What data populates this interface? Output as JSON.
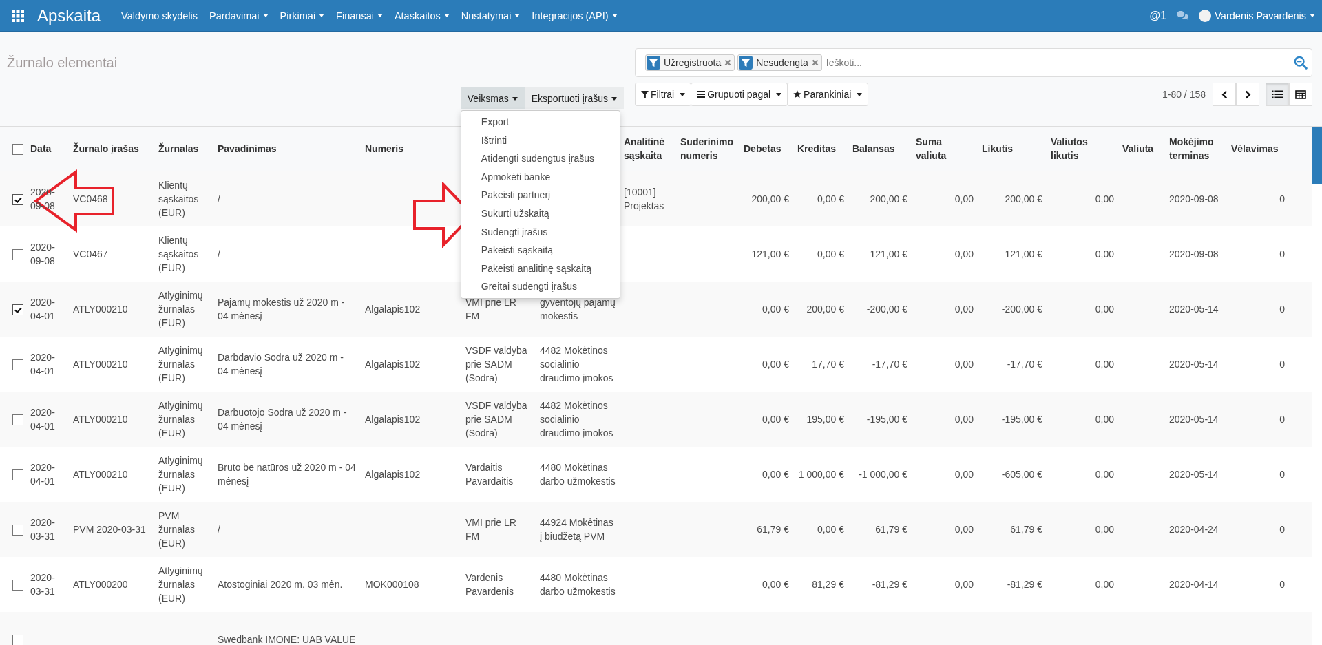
{
  "navbar": {
    "app_name": "Apskaita",
    "menu": [
      {
        "label": "Valdymo skydelis",
        "dropdown": false
      },
      {
        "label": "Pardavimai",
        "dropdown": true
      },
      {
        "label": "Pirkimai",
        "dropdown": true
      },
      {
        "label": "Finansai",
        "dropdown": true
      },
      {
        "label": "Ataskaitos",
        "dropdown": true
      },
      {
        "label": "Nustatymai",
        "dropdown": true
      },
      {
        "label": "Integracijos (API)",
        "dropdown": true
      }
    ],
    "mentions": {
      "symbol": "@",
      "count": "1"
    },
    "user": {
      "name": "Vardenis Pavardenis"
    }
  },
  "control_panel": {
    "title": "Žurnalo elementai",
    "actions": [
      {
        "label": "Veiksmas",
        "open": true,
        "menu": [
          "Export",
          "Ištrinti",
          "Atidengti sudengtus įrašus",
          "Apmokėti banke",
          "Pakeisti partnerį",
          "Sukurti užskaitą",
          "Sudengti įrašus",
          "Pakeisti sąskaitą",
          "Pakeisti analitinę sąskaitą",
          "Greitai sudengti įrašus"
        ]
      },
      {
        "label": "Eksportuoti įrašus",
        "open": false
      }
    ],
    "search": {
      "facets": [
        "Užregistruota",
        "Nesudengta"
      ],
      "placeholder": "Ieškoti..."
    },
    "filter_buttons": [
      {
        "kind": "filter",
        "label": "Filtrai"
      },
      {
        "kind": "group",
        "label": "Grupuoti pagal"
      },
      {
        "kind": "favorite",
        "label": "Parankiniai"
      }
    ],
    "pager": "1-80 / 158",
    "views": [
      {
        "kind": "list",
        "selected": true
      },
      {
        "kind": "grid",
        "selected": false
      }
    ]
  },
  "table": {
    "select_all": {
      "checked": false
    },
    "columns": [
      "Data",
      "Žurnalo įrašas",
      "Žurnalas",
      "Pavadinimas",
      "Numeris",
      null,
      null,
      "Analitinė sąskaita",
      "Suderinimo numeris",
      "Debetas",
      "Kreditas",
      "Balansas",
      "Suma valiuta",
      "Likutis",
      "Valiutos likutis",
      "Valiuta",
      "Mokėjimo terminas",
      "Vėlavimas"
    ],
    "rows": [
      {
        "selected": true,
        "cells": [
          "2020-09-08",
          "VC0468",
          "Klientų sąskaitos (EUR)",
          "/",
          null,
          null,
          null,
          "[10001] Projektas",
          null,
          "200,00 €",
          "0,00 €",
          "200,00 €",
          "0,00",
          "200,00 €",
          "0,00",
          null,
          "2020-09-08",
          "0"
        ]
      },
      {
        "selected": false,
        "cells": [
          "2020-09-08",
          "VC0467",
          "Klientų sąskaitos (EUR)",
          "/",
          null,
          null,
          null,
          null,
          null,
          "121,00 €",
          "0,00 €",
          "121,00 €",
          "0,00",
          "121,00 €",
          "0,00",
          null,
          "2020-09-08",
          "0"
        ]
      },
      {
        "selected": true,
        "cells": [
          "2020-04-01",
          "ATLY000210",
          "Atlyginimų žurnalas (EUR)",
          "Pajamų mokestis už 2020 m - 04 mėnesį",
          "Algalapis102",
          "VMI prie LR FM",
          "gyventojų pajamų mokestis",
          null,
          null,
          "0,00 €",
          "200,00 €",
          "-200,00 €",
          "0,00",
          "-200,00 €",
          "0,00",
          null,
          "2020-05-14",
          "0"
        ]
      },
      {
        "selected": false,
        "cells": [
          "2020-04-01",
          "ATLY000210",
          "Atlyginimų žurnalas (EUR)",
          "Darbdavio Sodra už 2020 m - 04 mėnesį",
          "Algalapis102",
          "VSDF valdyba prie SADM (Sodra)",
          "4482 Mokėtinos socialinio draudimo įmokos",
          null,
          null,
          "0,00 €",
          "17,70 €",
          "-17,70 €",
          "0,00",
          "-17,70 €",
          "0,00",
          null,
          "2020-05-14",
          "0"
        ]
      },
      {
        "selected": false,
        "cells": [
          "2020-04-01",
          "ATLY000210",
          "Atlyginimų žurnalas (EUR)",
          "Darbuotojo Sodra už 2020 m - 04 mėnesį",
          "Algalapis102",
          "VSDF valdyba prie SADM (Sodra)",
          "4482 Mokėtinos socialinio draudimo įmokos",
          null,
          null,
          "0,00 €",
          "195,00 €",
          "-195,00 €",
          "0,00",
          "-195,00 €",
          "0,00",
          null,
          "2020-05-14",
          "0"
        ]
      },
      {
        "selected": false,
        "cells": [
          "2020-04-01",
          "ATLY000210",
          "Atlyginimų žurnalas (EUR)",
          "Bruto be natūros už 2020 m - 04 mėnesį",
          "Algalapis102",
          "Vardaitis Pavardaitis",
          "4480 Mokėtinas darbo užmokestis",
          null,
          null,
          "0,00 €",
          "1 000,00 €",
          "-1 000,00 €",
          "0,00",
          "-605,00 €",
          "0,00",
          null,
          "2020-05-14",
          "0"
        ]
      },
      {
        "selected": false,
        "cells": [
          "2020-03-31",
          "PVM 2020-03-31",
          "PVM žurnalas (EUR)",
          "/",
          null,
          "VMI prie LR FM",
          "44924 Mokėtinas į biudžetą PVM",
          null,
          null,
          "61,79 €",
          "0,00 €",
          "61,79 €",
          "0,00",
          "61,79 €",
          "0,00",
          null,
          "2020-04-24",
          "0"
        ]
      },
      {
        "selected": false,
        "cells": [
          "2020-03-31",
          "ATLY000200",
          "Atlyginimų žurnalas (EUR)",
          "Atostoginiai 2020 m. 03 mėn.",
          "MOK000108",
          "Vardenis Pavardenis",
          "4480 Mokėtinas darbo užmokestis",
          null,
          null,
          "0,00 €",
          "81,29 €",
          "-81,29 €",
          "0,00",
          "-81,29 €",
          "0,00",
          null,
          "2020-04-14",
          "0"
        ]
      },
      {
        "selected": false,
        "cells": [
          null,
          null,
          null,
          "Swedbank IMONE: UAB VALUE",
          null,
          null,
          null,
          null,
          null,
          null,
          null,
          null,
          null,
          null,
          null,
          null,
          null,
          null
        ]
      }
    ]
  }
}
